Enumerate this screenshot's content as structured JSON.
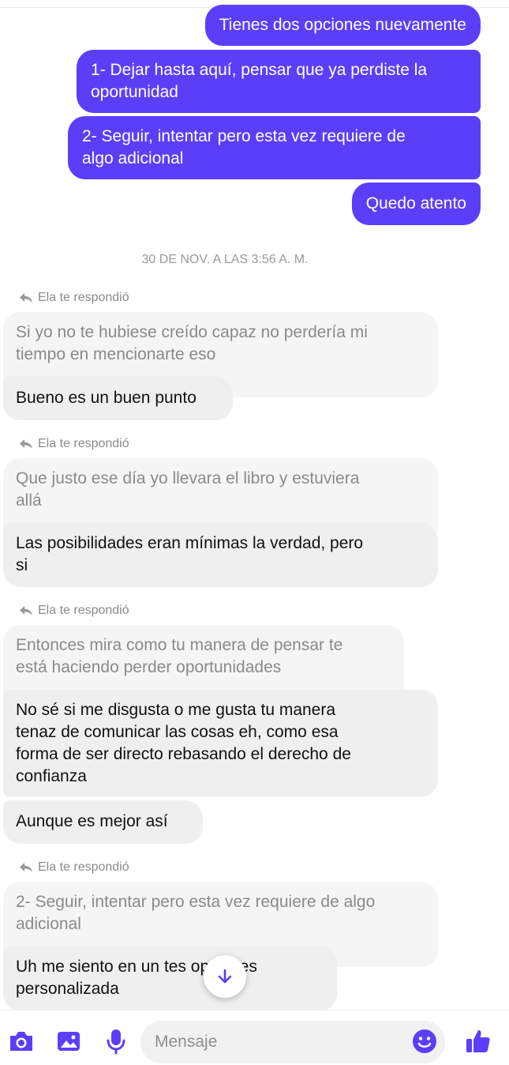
{
  "colors": {
    "accent": "#5b3ff8",
    "incoming_bg": "#efefef",
    "quote_bg": "#f5f5f5"
  },
  "outgoing": [
    "Tienes dos opciones nuevamente",
    "1- Dejar hasta aquí, pensar que ya perdiste la\noportunidad",
    "2- Seguir, intentar pero esta vez requiere de\nalgo adicional",
    "Quedo atento"
  ],
  "timestamp": "30 DE NOV. A LAS 3:56 A. M.",
  "reply_label": "Ela te respondió",
  "groups": [
    {
      "quote": "Si yo no te hubiese creído capaz no perdería mi\ntiempo en mencionarte eso",
      "messages": [
        "Bueno es un buen punto"
      ]
    },
    {
      "quote": "Que justo ese día yo llevara el libro y estuviera\nallá",
      "messages": [
        "Las posibilidades eran mínimas la verdad, pero\nsi"
      ]
    },
    {
      "quote": "Entonces mira como tu manera de pensar te\nestá haciendo perder oportunidades",
      "messages": [
        "No sé si me disgusta o me gusta tu manera\ntenaz de comunicar las cosas eh, como esa\nforma de ser directo rebasando el derecho de\nconfianza",
        "Aunque es mejor así"
      ]
    },
    {
      "quote": "2- Seguir, intentar pero esta vez requiere de algo\nadicional",
      "messages": [
        "Uh me siento en un tes      opciones\npersonalizada"
      ]
    }
  ],
  "composer": {
    "placeholder": "Mensaje",
    "icons": [
      "camera-icon",
      "gallery-icon",
      "microphone-icon",
      "emoji-icon",
      "thumbs-up-icon"
    ]
  },
  "scroll_down_icon": "arrow-down-icon"
}
